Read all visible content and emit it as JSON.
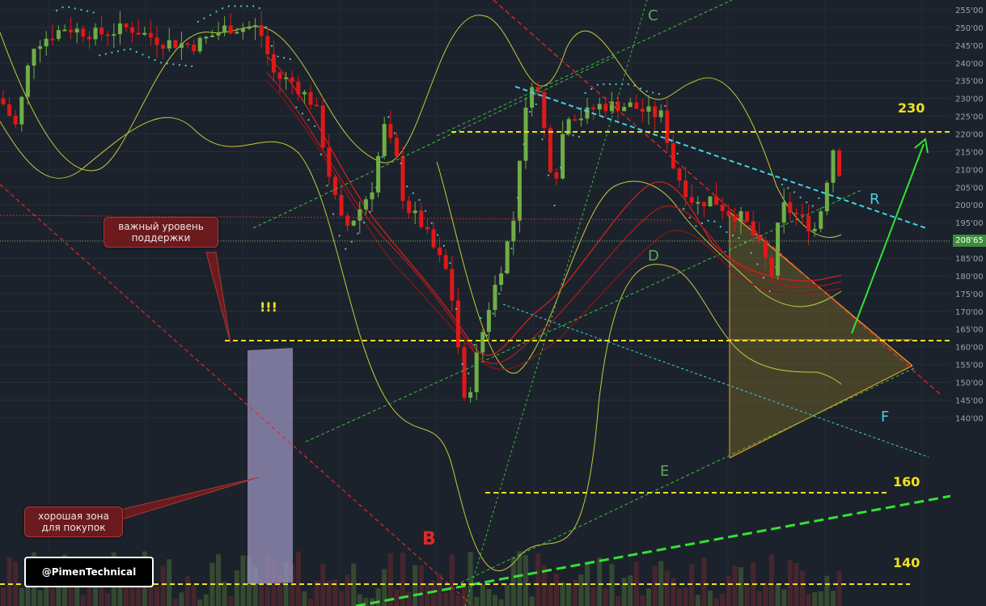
{
  "chart_data": {
    "type": "candlestick",
    "y_ticks": [
      "255'00",
      "250'00",
      "245'00",
      "240'00",
      "235'00",
      "230'00",
      "225'00",
      "220'00",
      "215'00",
      "210'00",
      "205'00",
      "200'00",
      "195'00",
      "190'00",
      "185'00",
      "180'00",
      "175'00",
      "170'00",
      "165'00",
      "160'00",
      "155'00",
      "150'00",
      "145'00",
      "140'00"
    ],
    "ylim": [
      138,
      257
    ],
    "current_price": "208'65",
    "levels": [
      {
        "label": "230",
        "value": 230.5
      },
      {
        "label": "160",
        "value": 158.5
      },
      {
        "label": "140",
        "value": 140.5
      }
    ],
    "support_level": 189,
    "annotations": {
      "point_B": "B",
      "point_C": "C",
      "point_D": "D",
      "point_E": "E",
      "point_F": "F",
      "point_R": "R",
      "exclamation": "!!!"
    },
    "callouts": {
      "support": "важный уровень поддержки",
      "buy_zone": "хорошая зона для покупок"
    }
  },
  "brand": {
    "label": "@PimenTechnical"
  },
  "colors": {
    "background": "#1c222b",
    "up_candle": "#6fae45",
    "down_candle": "#e01818",
    "level_line": "#f0e020",
    "trend_red": "#e02a2a",
    "channel_green": "#3cbf3c",
    "resistance_cyan": "#3ad6e8",
    "triangle_fill": "#7a6a2a",
    "triangle_edge": "#f0a020"
  }
}
